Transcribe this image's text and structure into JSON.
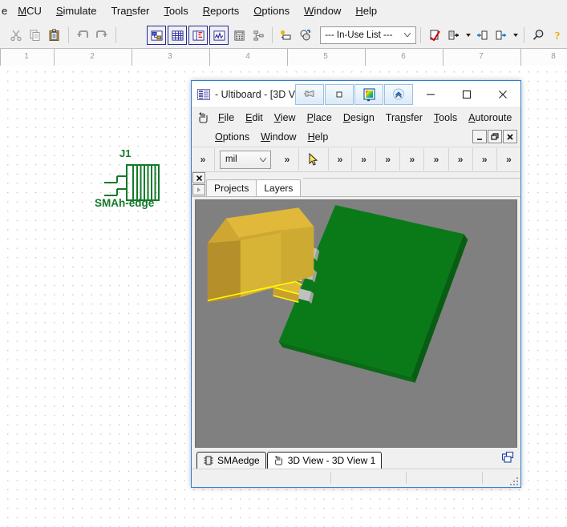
{
  "host_app": {
    "menubar": [
      {
        "label": "e",
        "mnemonic": "",
        "clipped": true
      },
      {
        "label": "MCU",
        "mnemonic": "M"
      },
      {
        "label": "Simulate",
        "mnemonic": "S"
      },
      {
        "label": "Transfer",
        "mnemonic": "n"
      },
      {
        "label": "Tools",
        "mnemonic": "T"
      },
      {
        "label": "Reports",
        "mnemonic": "R"
      },
      {
        "label": "Options",
        "mnemonic": "O"
      },
      {
        "label": "Window",
        "mnemonic": "W"
      },
      {
        "label": "Help",
        "mnemonic": "H"
      }
    ],
    "toolbar": {
      "left_icons": [
        {
          "name": "cut-icon",
          "state": "disabled"
        },
        {
          "name": "copy-icon",
          "state": "disabled"
        },
        {
          "name": "paste-icon",
          "state": "enabled"
        },
        {
          "name": "undo-icon",
          "state": "disabled"
        },
        {
          "name": "redo-icon",
          "state": "disabled"
        }
      ],
      "view_icons": [
        {
          "name": "design-toolbox-icon",
          "framed": true
        },
        {
          "name": "spreadsheet-view-icon",
          "framed": true
        },
        {
          "name": "sp-database-icon",
          "framed": true
        },
        {
          "name": "grapher-icon",
          "framed": true
        },
        {
          "name": "postprocessor-icon",
          "framed": false
        },
        {
          "name": "hierarchy-icon",
          "framed": false
        }
      ],
      "place_icons": [
        {
          "name": "new-component-icon"
        },
        {
          "name": "simulation-switch-icon"
        }
      ],
      "inuse_list": {
        "value": "--- In-Use List ---",
        "name": "in-use-list-dropdown"
      },
      "right_icons": [
        {
          "name": "erc-check-icon",
          "has_caret": false
        },
        {
          "name": "transfer-to-ultiboard-icon",
          "has_caret": true
        },
        {
          "name": "back-annotate-icon",
          "has_caret": false
        },
        {
          "name": "forward-annotate-icon",
          "has_caret": true
        },
        {
          "name": "zoom-icon",
          "has_caret": false
        },
        {
          "name": "help-icon",
          "has_caret": false
        }
      ]
    },
    "ruler": {
      "ticks": [
        "1",
        "2",
        "3",
        "4",
        "5",
        "6",
        "7",
        "8"
      ]
    },
    "schematic": {
      "component": {
        "refdes": "J1",
        "name": "SMAh-edge",
        "color": "#137a2a"
      }
    }
  },
  "ultiboard": {
    "title": " - Ultiboard - [3D V",
    "window_buttons": [
      {
        "name": "minimize-button",
        "glyph": "—"
      },
      {
        "name": "maximize-button",
        "glyph": "☐"
      },
      {
        "name": "close-button",
        "glyph": "✕"
      }
    ],
    "float_toolbar": [
      {
        "name": "pin-icon"
      },
      {
        "name": "small-square-icon"
      },
      {
        "name": "color-palette-icon"
      },
      {
        "name": "chevron-up-circle-icon"
      }
    ],
    "menubar_row1": [
      {
        "label": "File",
        "mnemonic": "F"
      },
      {
        "label": "Edit",
        "mnemonic": "E"
      },
      {
        "label": "View",
        "mnemonic": "V"
      },
      {
        "label": "Place",
        "mnemonic": "P"
      },
      {
        "label": "Design",
        "mnemonic": "D"
      },
      {
        "label": "Transfer",
        "mnemonic": "n"
      },
      {
        "label": "Tools",
        "mnemonic": "T"
      },
      {
        "label": "Autoroute",
        "mnemonic": "A"
      }
    ],
    "menubar_row2": [
      {
        "label": "Options",
        "mnemonic": "O"
      },
      {
        "label": "Window",
        "mnemonic": "W"
      },
      {
        "label": "Help",
        "mnemonic": "H"
      }
    ],
    "mdi_controls": [
      {
        "name": "mdi-minimize-button",
        "glyph": "_"
      },
      {
        "name": "mdi-restore-button",
        "glyph": "❐"
      },
      {
        "name": "mdi-close-button",
        "glyph": "✕"
      }
    ],
    "toolstrip": {
      "unit_combo": {
        "value": "mil",
        "name": "unit-dropdown"
      },
      "overflow_label": "»",
      "overflow_count_left": 1,
      "overflow_count_right": 9,
      "cursor_tool": {
        "name": "select-arrow-icon"
      }
    },
    "panel_tabs": [
      {
        "label": "Projects",
        "active": false
      },
      {
        "label": "Layers",
        "active": true
      }
    ],
    "panel_close": {
      "glyph": "✕",
      "name": "panel-close-button"
    },
    "panel_expand": {
      "glyph": "▸",
      "name": "panel-expand-button"
    },
    "doc_tabs": [
      {
        "label": "SMAedge",
        "icon": "ic-chip-icon",
        "active": false
      },
      {
        "label": "3D View - 3D View 1",
        "icon": "hand-3d-icon",
        "active": true
      }
    ],
    "doctabs_right_icon": {
      "name": "tile-windows-icon"
    },
    "statusbar": {
      "panes": [
        "",
        "",
        "",
        ""
      ]
    },
    "viewport": {
      "name": "3d-view-canvas",
      "background": "#808080",
      "pcb_color_top": "#0a7a19",
      "pcb_color_side": "#0a6614",
      "connector_color_top": "#e0b93a",
      "connector_color_front": "#c9a02f",
      "connector_color_side": "#b08c28",
      "pad_color": "#c0c0c0",
      "highlight_color": "#ffff00",
      "description": "3D rendered PCB with gold SMA edge connector and three pins"
    }
  }
}
